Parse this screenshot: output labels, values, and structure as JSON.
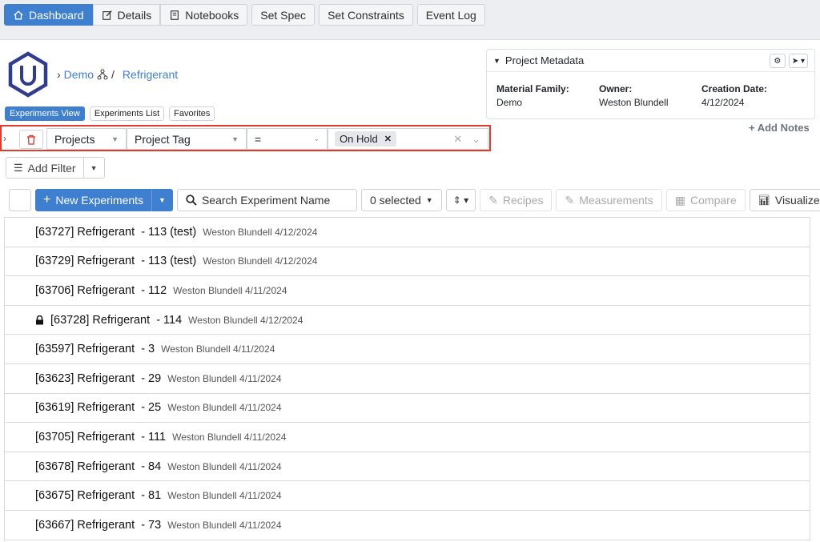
{
  "nav": {
    "dashboard": "Dashboard",
    "details": "Details",
    "notebooks": "Notebooks",
    "set_spec": "Set Spec",
    "set_constraints": "Set Constraints",
    "event_log": "Event Log"
  },
  "breadcrumb": {
    "root": "Demo",
    "current": "Refrigerant"
  },
  "view_tabs": {
    "experiments_view": "Experiments View",
    "experiments_list": "Experiments List",
    "favorites": "Favorites"
  },
  "metadata": {
    "title": "Project Metadata",
    "material_family_label": "Material Family:",
    "material_family": "Demo",
    "owner_label": "Owner:",
    "owner": "Weston Blundell",
    "creation_date_label": "Creation Date:",
    "creation_date": "4/12/2024"
  },
  "add_notes": "+ Add Notes",
  "filter": {
    "field1": "Projects",
    "field2": "Project Tag",
    "operator": "=",
    "value_chip": "On Hold"
  },
  "add_filter": "Add Filter",
  "toolbar": {
    "new_experiments": "New Experiments",
    "search_placeholder": "Search Experiment Name",
    "selected": "0 selected",
    "recipes": "Recipes",
    "measurements": "Measurements",
    "compare": "Compare",
    "visualize": "Visualize"
  },
  "experiments": [
    {
      "name": "[63727] Refrigerant  - 113 (test)",
      "meta": "Weston Blundell 4/12/2024",
      "locked": false
    },
    {
      "name": "[63729] Refrigerant  - 113 (test)",
      "meta": "Weston Blundell 4/12/2024",
      "locked": false
    },
    {
      "name": "[63706] Refrigerant  - 112",
      "meta": "Weston Blundell 4/11/2024",
      "locked": false
    },
    {
      "name": "[63728] Refrigerant  - 114",
      "meta": "Weston Blundell 4/12/2024",
      "locked": true
    },
    {
      "name": "[63597] Refrigerant  - 3",
      "meta": "Weston Blundell 4/11/2024",
      "locked": false
    },
    {
      "name": "[63623] Refrigerant  - 29",
      "meta": "Weston Blundell 4/11/2024",
      "locked": false
    },
    {
      "name": "[63619] Refrigerant  - 25",
      "meta": "Weston Blundell 4/11/2024",
      "locked": false
    },
    {
      "name": "[63705] Refrigerant  - 111",
      "meta": "Weston Blundell 4/11/2024",
      "locked": false
    },
    {
      "name": "[63678] Refrigerant  - 84",
      "meta": "Weston Blundell 4/11/2024",
      "locked": false
    },
    {
      "name": "[63675] Refrigerant  - 81",
      "meta": "Weston Blundell 4/11/2024",
      "locked": false
    },
    {
      "name": "[63667] Refrigerant  - 73",
      "meta": "Weston Blundell 4/11/2024",
      "locked": false
    }
  ]
}
